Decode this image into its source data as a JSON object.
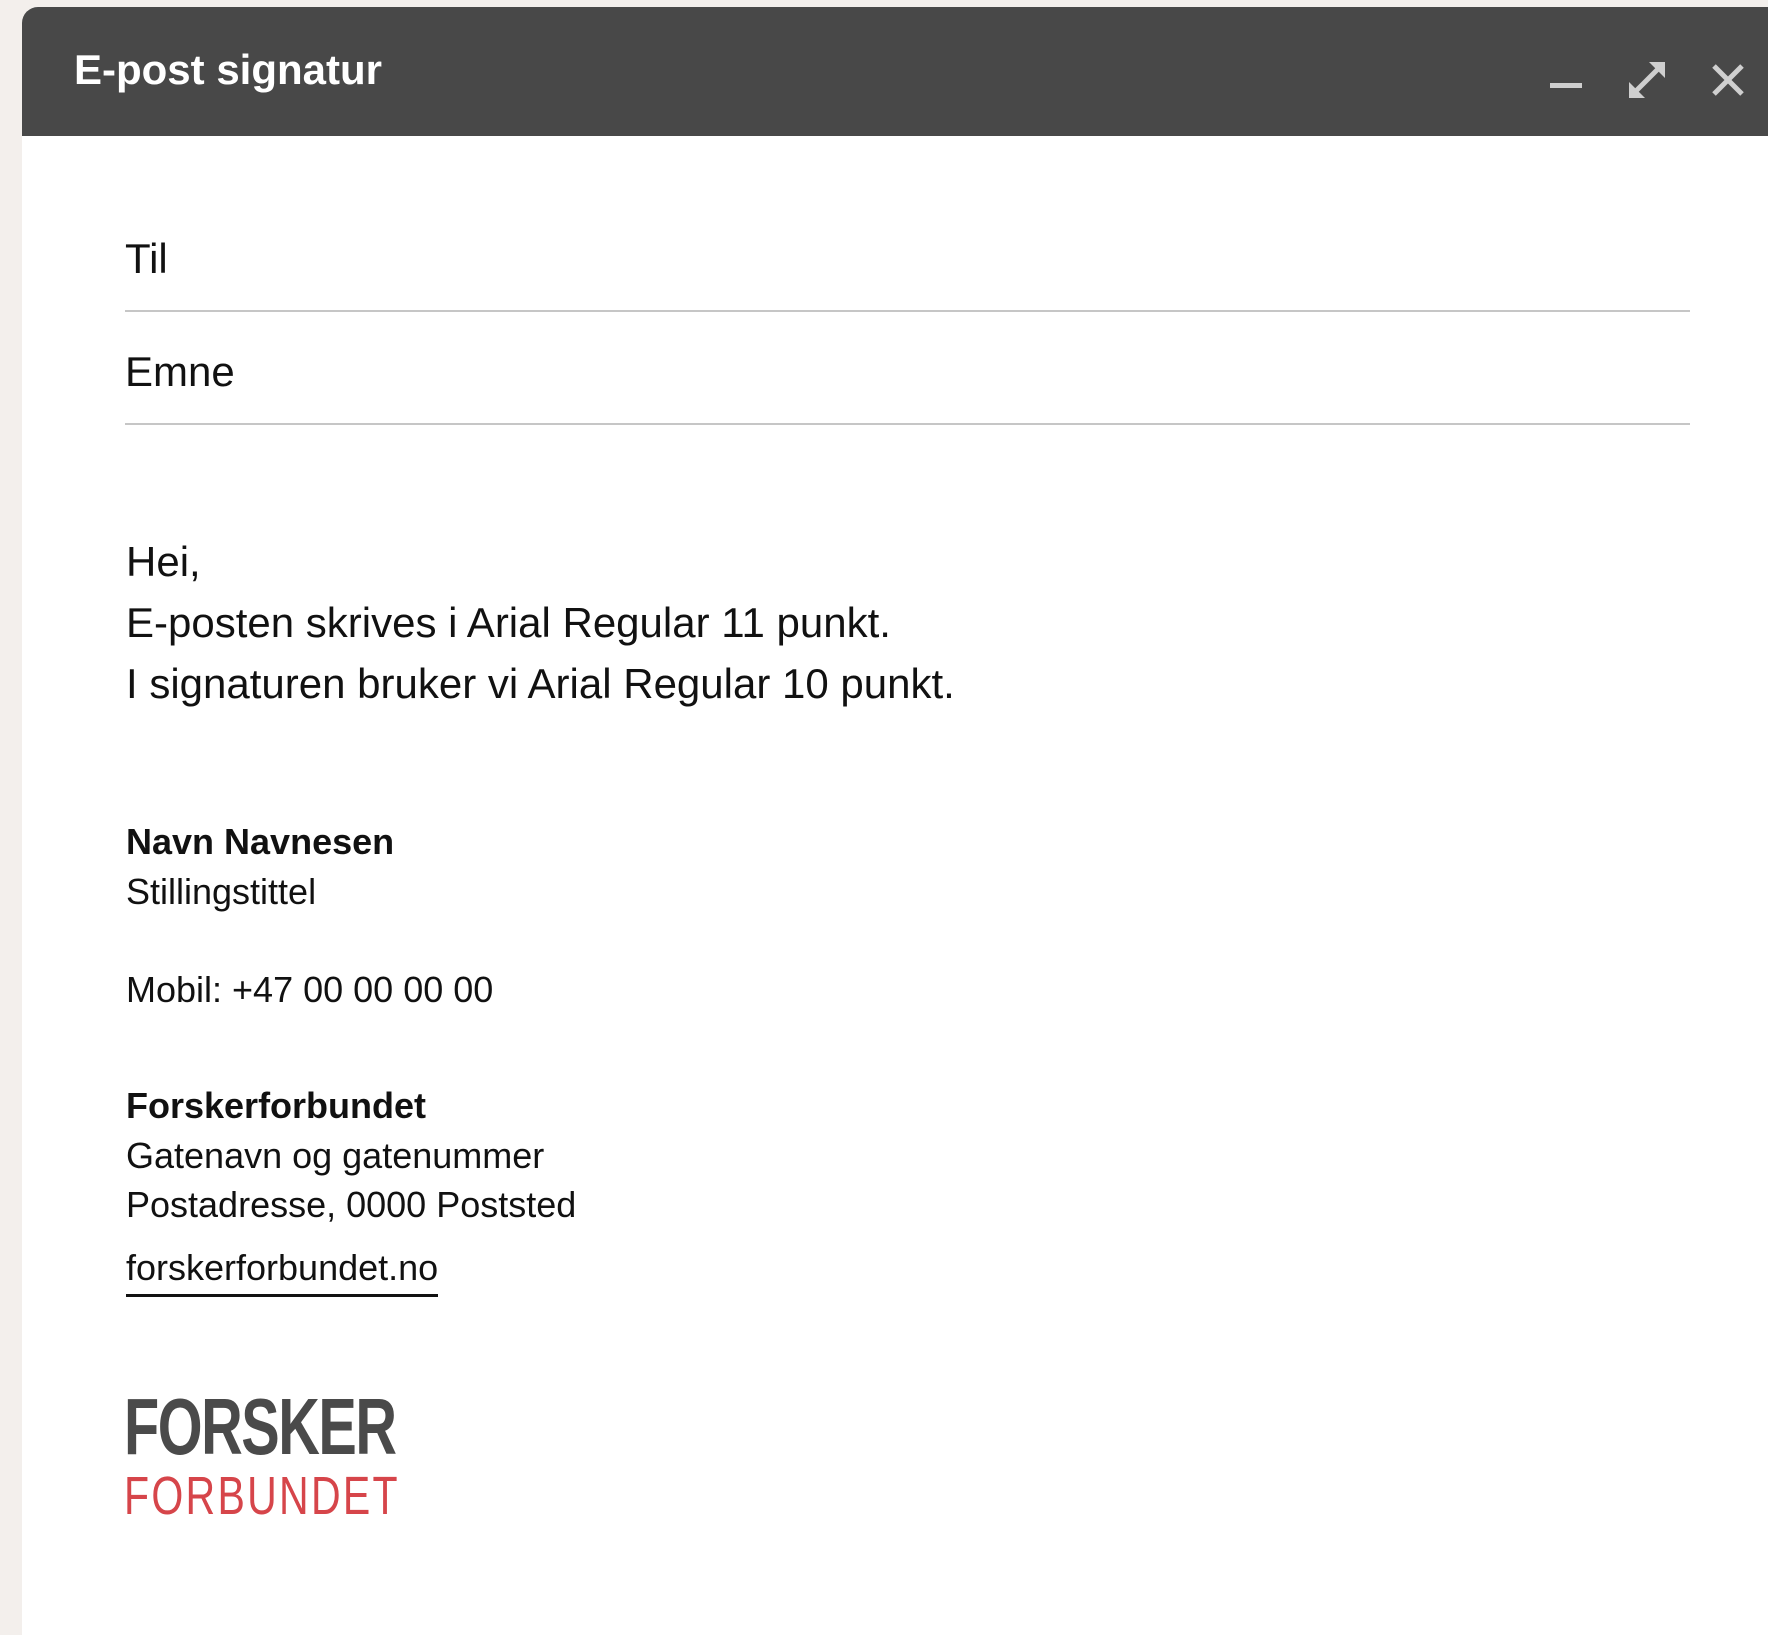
{
  "window": {
    "title": "E-post signatur",
    "controls": {
      "minimize_icon": "minimize-icon",
      "maximize_icon": "expand-icon",
      "close_icon": "close-icon"
    }
  },
  "fields": {
    "to_label": "Til",
    "subject_label": "Emne"
  },
  "body": {
    "lines": [
      "Hei,",
      "E-posten skrives i Arial Regular 11 punkt.",
      "I signaturen bruker vi Arial Regular 10 punkt."
    ]
  },
  "signature": {
    "name": "Navn Navnesen",
    "job_title": "Stillingstittel",
    "mobile": "Mobil: +47 00 00 00 00",
    "organization": "Forskerforbundet",
    "street": "Gatenavn og gatenummer",
    "postal": "Postadresse, 0000 Poststed",
    "website": "forskerforbundet.no"
  },
  "logo": {
    "line1": "FORSKER",
    "line2": "FORBUNDET",
    "colors": {
      "line1": "#4a4a4a",
      "line2": "#d6454a"
    }
  },
  "colors": {
    "titlebar": "#484848",
    "background": "#f3efec",
    "divider": "#c6c6c6"
  }
}
